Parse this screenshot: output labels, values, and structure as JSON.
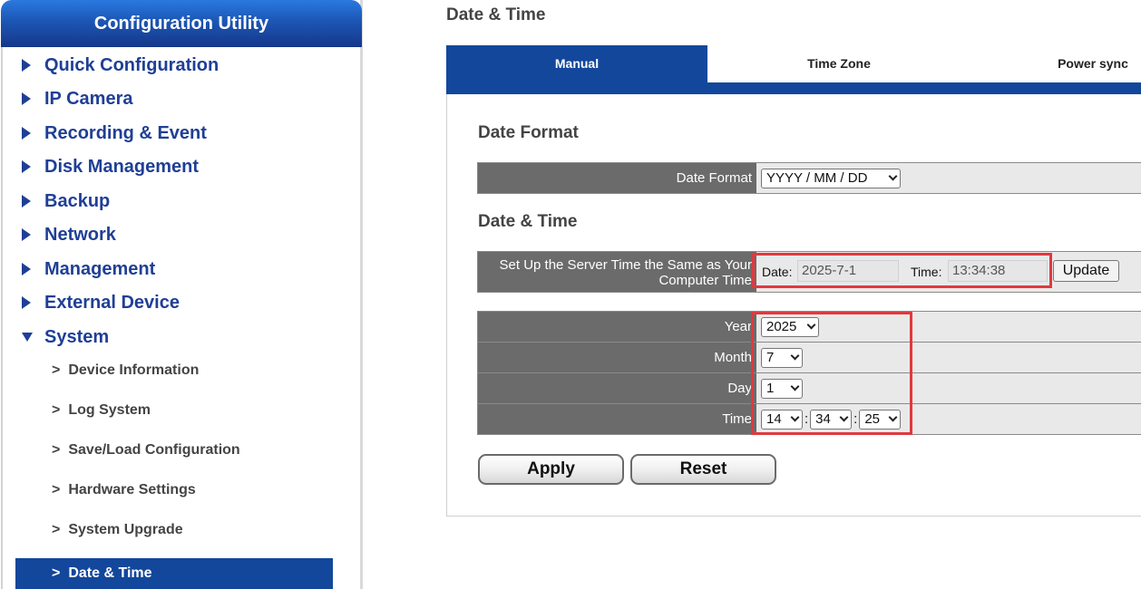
{
  "sidebar": {
    "title": "Configuration Utility",
    "items": [
      {
        "label": "Quick Configuration"
      },
      {
        "label": "IP Camera"
      },
      {
        "label": "Recording & Event"
      },
      {
        "label": "Disk Management"
      },
      {
        "label": "Backup"
      },
      {
        "label": "Network"
      },
      {
        "label": "Management"
      },
      {
        "label": "External Device"
      },
      {
        "label": "System"
      }
    ],
    "subitems": [
      {
        "label": "Device Information"
      },
      {
        "label": "Log System"
      },
      {
        "label": "Save/Load Configuration"
      },
      {
        "label": "Hardware Settings"
      },
      {
        "label": "System Upgrade"
      },
      {
        "label": "Date & Time"
      }
    ],
    "sub_arrow": ">"
  },
  "page": {
    "title": "Date & Time"
  },
  "tabs": [
    {
      "label": "Manual"
    },
    {
      "label": "Time Zone"
    },
    {
      "label": "Power sync"
    }
  ],
  "date_format": {
    "section_title": "Date Format",
    "label": "Date Format",
    "value": "YYYY / MM / DD"
  },
  "date_time": {
    "section_title": "Date & Time",
    "sync_label": "Set Up the Server Time the Same as Your Computer Time",
    "date_label": "Date:",
    "date_value": "2025-7-1",
    "time_label": "Time:",
    "time_value": "13:34:38",
    "update_label": "Update",
    "year_label": "Year",
    "year_value": "2025",
    "month_label": "Month",
    "month_value": "7",
    "day_label": "Day",
    "day_value": "1",
    "time_row_label": "Time",
    "hour_value": "14",
    "minute_value": "34",
    "second_value": "25",
    "separator": ":"
  },
  "actions": {
    "apply": "Apply",
    "reset": "Reset"
  },
  "colors": {
    "accent": "#13479b",
    "highlight": "#e0393e",
    "label_bg": "#6b6b6b"
  }
}
